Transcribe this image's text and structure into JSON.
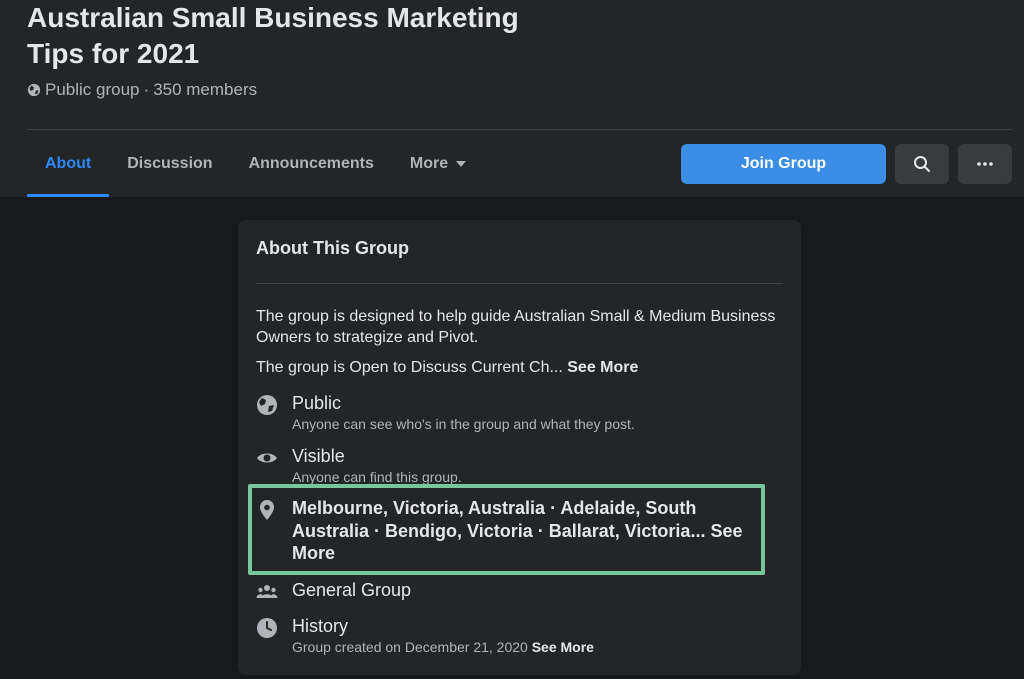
{
  "header": {
    "title": "Australian Small Business Marketing Tips for 2021",
    "privacy": "Public group",
    "separator": "·",
    "members": "350 members"
  },
  "tabs": [
    {
      "label": "About",
      "active": true
    },
    {
      "label": "Discussion"
    },
    {
      "label": "Announcements"
    },
    {
      "label": "More"
    }
  ],
  "actions": {
    "join_label": "Join Group",
    "search_icon": "search-icon",
    "more_icon": "ellipsis-icon"
  },
  "about": {
    "title": "About This Group",
    "description_1": "The group is designed to help guide Australian Small & Medium Business Owners to strategize and Pivot.",
    "description_2": "The group is Open to Discuss Current Ch...",
    "see_more": "See More",
    "public": {
      "title": "Public",
      "subtitle": "Anyone can see who's in the group and what they post."
    },
    "visible": {
      "title": "Visible",
      "subtitle": "Anyone can find this group."
    },
    "location": {
      "text": "Melbourne, Victoria, Australia · Adelaide, South Australia · Bendigo, Victoria · Ballarat, Victoria...",
      "see_more": "See More"
    },
    "general": {
      "title": "General Group"
    },
    "history": {
      "title": "History",
      "subtitle": "Group created on December 21, 2020",
      "see_more": "See More"
    }
  },
  "colors": {
    "accent": "#2d88ff",
    "highlight": "#77c79a",
    "background": "#18191a",
    "surface": "#242526"
  }
}
